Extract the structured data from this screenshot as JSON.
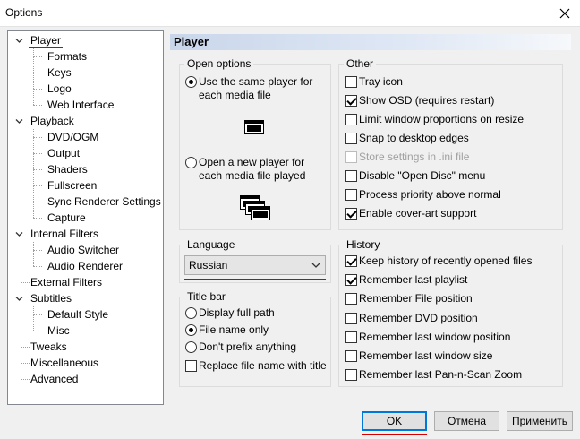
{
  "window": {
    "title": "Options"
  },
  "tree": [
    {
      "label": "Player",
      "expandable": true,
      "selected": true
    },
    {
      "label": "Formats"
    },
    {
      "label": "Keys"
    },
    {
      "label": "Logo"
    },
    {
      "label": "Web Interface"
    },
    {
      "label": "Playback",
      "expandable": true
    },
    {
      "label": "DVD/OGM"
    },
    {
      "label": "Output"
    },
    {
      "label": "Shaders"
    },
    {
      "label": "Fullscreen"
    },
    {
      "label": "Sync Renderer Settings"
    },
    {
      "label": "Capture"
    },
    {
      "label": "Internal Filters",
      "expandable": true
    },
    {
      "label": "Audio Switcher"
    },
    {
      "label": "Audio Renderer"
    },
    {
      "label": "External Filters"
    },
    {
      "label": "Subtitles",
      "expandable": true
    },
    {
      "label": "Default Style"
    },
    {
      "label": "Misc"
    },
    {
      "label": "Tweaks"
    },
    {
      "label": "Miscellaneous"
    },
    {
      "label": "Advanced"
    }
  ],
  "panel": {
    "title": "Player",
    "open_options": {
      "legend": "Open options",
      "same_player": {
        "label": "Use the same player for each media file",
        "checked": true
      },
      "new_player": {
        "label": "Open a new player for each media file played",
        "checked": false
      }
    },
    "language": {
      "legend": "Language",
      "selected": "Russian"
    },
    "title_bar": {
      "legend": "Title bar",
      "options": [
        {
          "label": "Display full path",
          "checked": false
        },
        {
          "label": "File name only",
          "checked": true
        },
        {
          "label": "Don't prefix anything",
          "checked": false
        }
      ],
      "replace": {
        "label": "Replace file name with title",
        "checked": false
      }
    },
    "other": {
      "legend": "Other",
      "items": [
        {
          "label": "Tray icon",
          "checked": false,
          "disabled": false
        },
        {
          "label": "Show OSD (requires restart)",
          "checked": true,
          "disabled": false
        },
        {
          "label": "Limit window proportions on resize",
          "checked": false,
          "disabled": false
        },
        {
          "label": "Snap to desktop edges",
          "checked": false,
          "disabled": false
        },
        {
          "label": "Store settings in .ini file",
          "checked": false,
          "disabled": true
        },
        {
          "label": "Disable \"Open Disc\" menu",
          "checked": false,
          "disabled": false
        },
        {
          "label": "Process priority above normal",
          "checked": false,
          "disabled": false
        },
        {
          "label": "Enable cover-art support",
          "checked": true,
          "disabled": false
        }
      ]
    },
    "history": {
      "legend": "History",
      "items": [
        {
          "label": "Keep history of recently opened files",
          "checked": true
        },
        {
          "label": "Remember last playlist",
          "checked": true
        },
        {
          "label": "Remember File position",
          "checked": false
        },
        {
          "label": "Remember DVD position",
          "checked": false
        },
        {
          "label": "Remember last window position",
          "checked": false
        },
        {
          "label": "Remember last window size",
          "checked": false
        },
        {
          "label": "Remember last Pan-n-Scan Zoom",
          "checked": false
        }
      ]
    }
  },
  "buttons": {
    "ok": "OK",
    "cancel": "Отмена",
    "apply": "Применить"
  },
  "colors": {
    "accent_red": "#d50000",
    "focus_blue": "#0078d7",
    "header_gradient": "#c9d6ea"
  }
}
